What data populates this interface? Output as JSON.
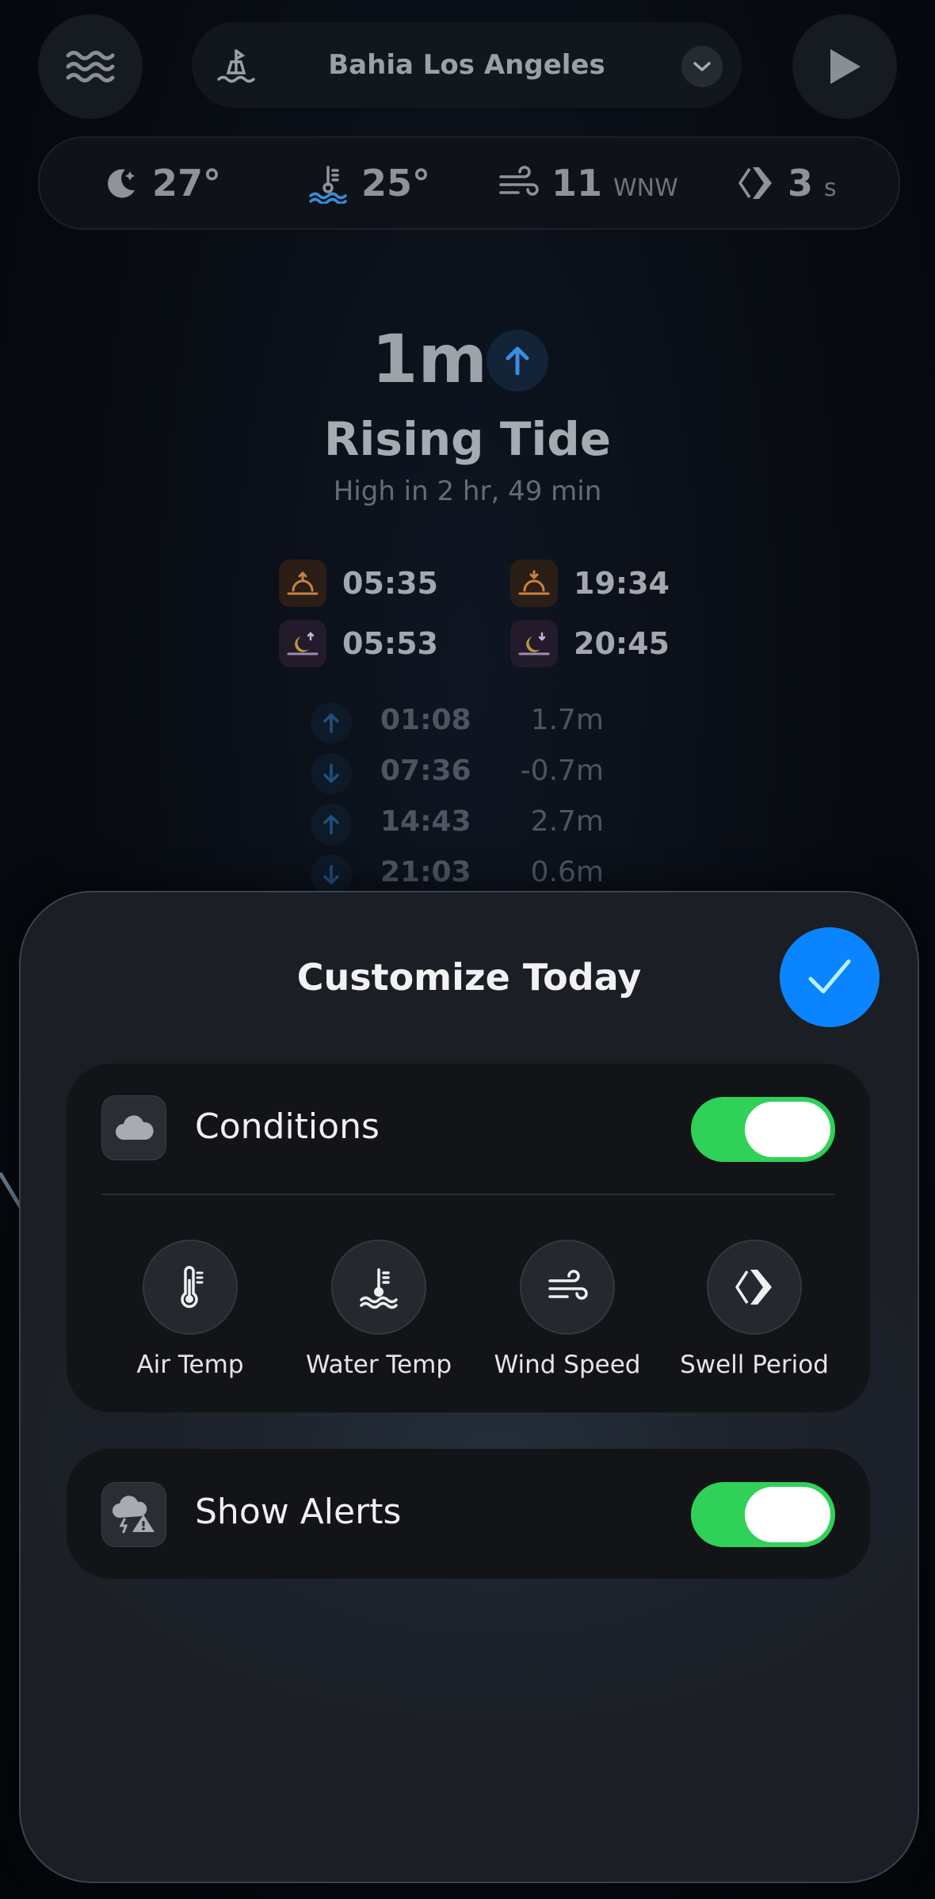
{
  "header": {
    "location": "Bahia Los Angeles"
  },
  "conditions_bar": {
    "air_temp": "27°",
    "water_temp": "25°",
    "wind_speed": "11",
    "wind_dir": "WNW",
    "swell_period": "3",
    "swell_unit": "s"
  },
  "tide": {
    "height": "1m",
    "state": "Rising Tide",
    "next": "High in 2 hr, 49 min"
  },
  "sun_moon": {
    "sunrise": "05:35",
    "sunset": "19:34",
    "moonrise": "05:53",
    "moonset": "20:45"
  },
  "tide_table": [
    {
      "dir": "up",
      "time": "01:08",
      "height": "1.7m"
    },
    {
      "dir": "down",
      "time": "07:36",
      "height": "-0.7m"
    },
    {
      "dir": "up",
      "time": "14:43",
      "height": "2.7m"
    },
    {
      "dir": "down",
      "time": "21:03",
      "height": "0.6m"
    }
  ],
  "sheet": {
    "title": "Customize Today",
    "conditions_label": "Conditions",
    "conditions_on": true,
    "metrics": [
      {
        "label": "Air Temp",
        "icon": "thermometer-icon"
      },
      {
        "label": "Water Temp",
        "icon": "water-temp-icon"
      },
      {
        "label": "Wind Speed",
        "icon": "wind-icon"
      },
      {
        "label": "Swell Period",
        "icon": "swell-icon"
      }
    ],
    "alerts_label": "Show Alerts",
    "alerts_on": true
  },
  "colors": {
    "accent": "#0a84ff",
    "toggle_on": "#30d158"
  }
}
